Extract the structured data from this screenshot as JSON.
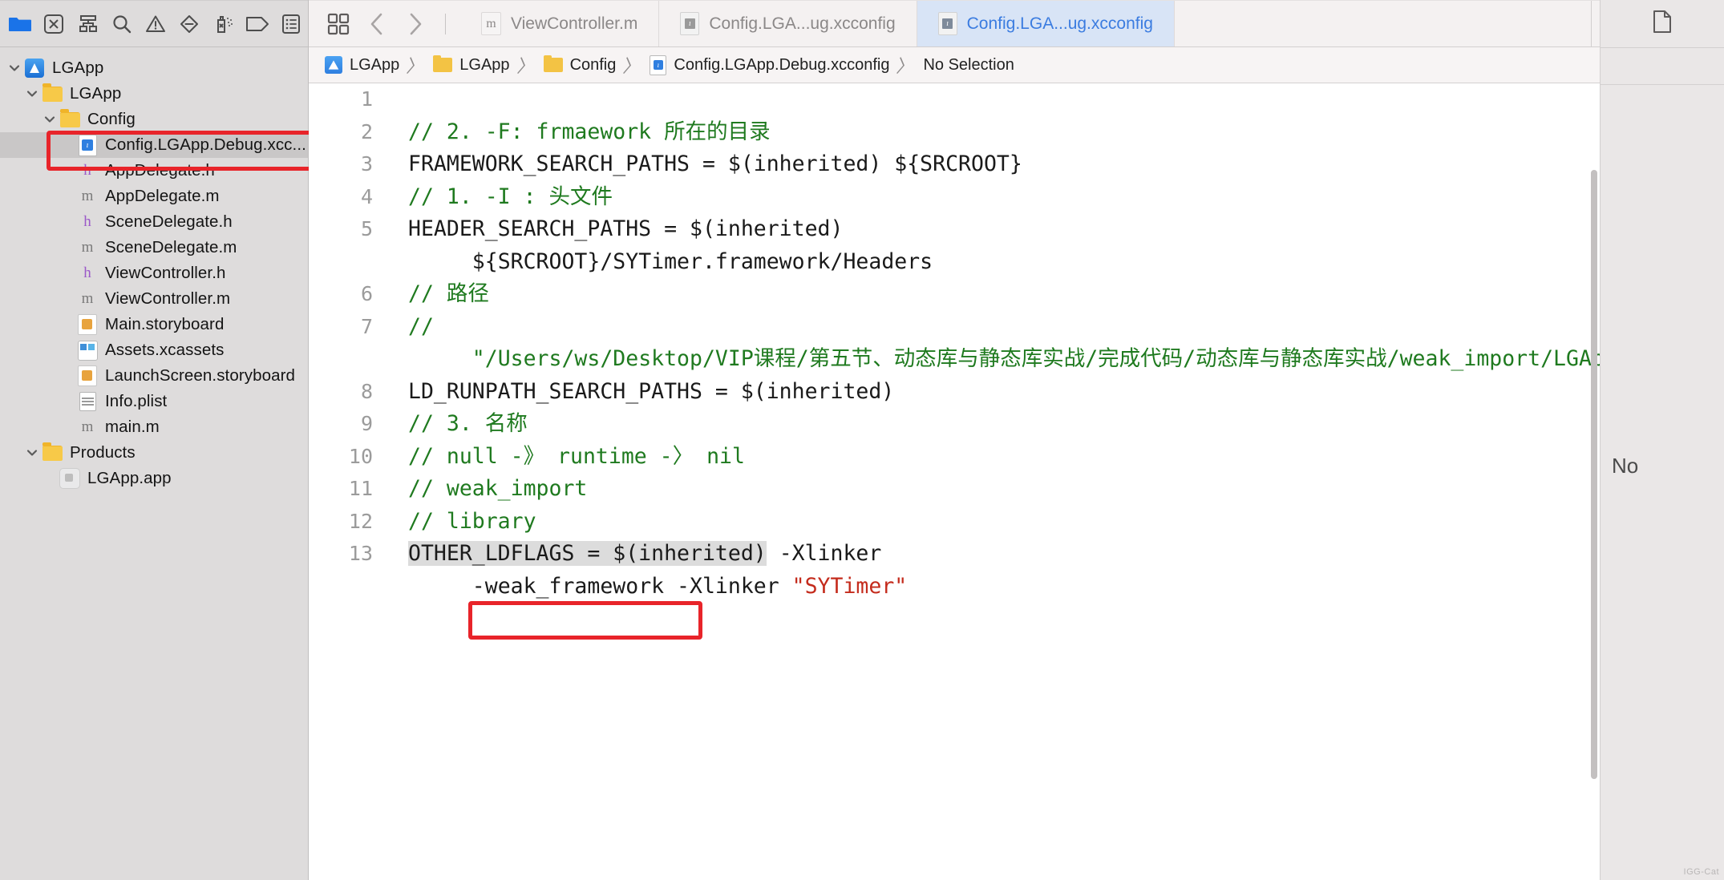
{
  "navigator": {
    "toolbar_icons": [
      {
        "name": "folder-icon",
        "label": "Project navigator"
      },
      {
        "name": "source-control-icon",
        "label": "Source control navigator"
      },
      {
        "name": "hierarchy-icon",
        "label": "Symbol navigator"
      },
      {
        "name": "search-icon",
        "label": "Find navigator"
      },
      {
        "name": "warning-icon",
        "label": "Issue navigator"
      },
      {
        "name": "test-diamond-icon",
        "label": "Test navigator"
      },
      {
        "name": "debug-spray-icon",
        "label": "Debug navigator"
      },
      {
        "name": "breakpoint-tag-icon",
        "label": "Breakpoint navigator"
      },
      {
        "name": "report-list-icon",
        "label": "Report navigator"
      }
    ],
    "tree": [
      {
        "label": "LGApp",
        "icon": "xcode-project-icon",
        "depth": 0,
        "twisty": "down",
        "selected": false
      },
      {
        "label": "LGApp",
        "icon": "folder-icon",
        "depth": 1,
        "twisty": "down",
        "selected": false
      },
      {
        "label": "Config",
        "icon": "folder-icon",
        "depth": 2,
        "twisty": "down",
        "selected": false
      },
      {
        "label": "Config.LGApp.Debug.xcc...",
        "icon": "xcconfig-file-icon",
        "depth": 3,
        "twisty": "none",
        "selected": true
      },
      {
        "label": "AppDelegate.h",
        "icon": "header-file-icon",
        "depth": 3,
        "twisty": "none",
        "selected": false
      },
      {
        "label": "AppDelegate.m",
        "icon": "objc-file-icon",
        "depth": 3,
        "twisty": "none",
        "selected": false
      },
      {
        "label": "SceneDelegate.h",
        "icon": "header-file-icon",
        "depth": 3,
        "twisty": "none",
        "selected": false
      },
      {
        "label": "SceneDelegate.m",
        "icon": "objc-file-icon",
        "depth": 3,
        "twisty": "none",
        "selected": false
      },
      {
        "label": "ViewController.h",
        "icon": "header-file-icon",
        "depth": 3,
        "twisty": "none",
        "selected": false
      },
      {
        "label": "ViewController.m",
        "icon": "objc-file-icon",
        "depth": 3,
        "twisty": "none",
        "selected": false
      },
      {
        "label": "Main.storyboard",
        "icon": "storyboard-icon",
        "depth": 3,
        "twisty": "none",
        "selected": false
      },
      {
        "label": "Assets.xcassets",
        "icon": "assets-icon",
        "depth": 3,
        "twisty": "none",
        "selected": false
      },
      {
        "label": "LaunchScreen.storyboard",
        "icon": "storyboard-icon",
        "depth": 3,
        "twisty": "none",
        "selected": false
      },
      {
        "label": "Info.plist",
        "icon": "plist-icon",
        "depth": 3,
        "twisty": "none",
        "selected": false
      },
      {
        "label": "main.m",
        "icon": "objc-file-icon",
        "depth": 3,
        "twisty": "none",
        "selected": false
      },
      {
        "label": "Products",
        "icon": "folder-icon",
        "depth": 1,
        "twisty": "down",
        "selected": false
      },
      {
        "label": "LGApp.app",
        "icon": "app-product-icon",
        "depth": 2,
        "twisty": "none",
        "selected": false
      }
    ]
  },
  "tabbar": {
    "left_icons": [
      {
        "name": "grid-editor-options-icon"
      },
      {
        "name": "back-chevron-icon"
      },
      {
        "name": "forward-chevron-icon"
      }
    ],
    "tabs": [
      {
        "label": "ViewController.m",
        "icon": "objc-file-icon",
        "active": false
      },
      {
        "label": "Config.LGA...ug.xcconfig",
        "icon": "xcconfig-file-icon",
        "active": false
      },
      {
        "label": "Config.LGA...ug.xcconfig",
        "icon": "xcconfig-file-icon",
        "active": true
      }
    ],
    "right_icons": [
      {
        "name": "minimap-icon"
      },
      {
        "name": "add-editor-icon"
      }
    ],
    "inspector_icon": {
      "name": "file-inspector-icon"
    }
  },
  "breadcrumb": {
    "items": [
      {
        "label": "LGApp",
        "icon": "xcode-project-icon"
      },
      {
        "label": "LGApp",
        "icon": "folder-icon"
      },
      {
        "label": "Config",
        "icon": "folder-icon"
      },
      {
        "label": "Config.LGApp.Debug.xcconfig",
        "icon": "xcconfig-file-icon"
      },
      {
        "label": "No Selection",
        "icon": "none"
      }
    ],
    "separator": "〉"
  },
  "editor": {
    "lines": [
      {
        "n": "1",
        "segments": [
          {
            "t": "",
            "c": "plain"
          }
        ]
      },
      {
        "n": "2",
        "segments": [
          {
            "t": "// 2. -F: frmaework 所在的目录",
            "c": "cmt"
          }
        ]
      },
      {
        "n": "3",
        "segments": [
          {
            "t": "FRAMEWORK_SEARCH_PATHS = $(inherited) ${SRCROOT}",
            "c": "plain"
          }
        ]
      },
      {
        "n": "4",
        "segments": [
          {
            "t": "// 1. -I : 头文件",
            "c": "cmt"
          }
        ]
      },
      {
        "n": "5",
        "segments": [
          {
            "t": "HEADER_SEARCH_PATHS = $(inherited)\n     ${SRCROOT}/SYTimer.framework/Headers",
            "c": "plain"
          }
        ]
      },
      {
        "n": "6",
        "segments": [
          {
            "t": "// 路径",
            "c": "cmt"
          }
        ]
      },
      {
        "n": "7",
        "segments": [
          {
            "t": "//\n     \"/Users/ws/Desktop/VIP课程/第五节、动态库与静态库实战/完成代码/动态库与静态库实战/weak_import/LGApp\"",
            "c": "cmt"
          }
        ]
      },
      {
        "n": "8",
        "segments": [
          {
            "t": "LD_RUNPATH_SEARCH_PATHS = $(inherited)",
            "c": "plain"
          }
        ]
      },
      {
        "n": "9",
        "segments": [
          {
            "t": "// 3. 名称",
            "c": "cmt"
          }
        ]
      },
      {
        "n": "10",
        "segments": [
          {
            "t": "// null -》 runtime -〉 nil",
            "c": "cmt"
          }
        ]
      },
      {
        "n": "11",
        "segments": [
          {
            "t": "// weak_import",
            "c": "cmt"
          }
        ]
      },
      {
        "n": "12",
        "segments": [
          {
            "t": "// library",
            "c": "cmt"
          }
        ]
      },
      {
        "n": "13",
        "segments": [
          {
            "t": "OTHER_LDFLAGS = $(inherited)",
            "c": "hl"
          },
          {
            "t": " -Xlinker\n     -weak_framework -Xlinker ",
            "c": "plain"
          },
          {
            "t": "\"SYTimer\"",
            "c": "str"
          }
        ]
      }
    ]
  },
  "inspector": {
    "no_selection_text": "No"
  },
  "annotations": {
    "red_box_color": "#e8242a",
    "boxes": [
      {
        "name": "config-file-highlight",
        "target": "Config.LGApp.Debug.xcc..."
      },
      {
        "name": "weak-framework-highlight",
        "target": "-weak_framework"
      }
    ]
  },
  "watermark": {
    "text": "IGG-Cat"
  }
}
